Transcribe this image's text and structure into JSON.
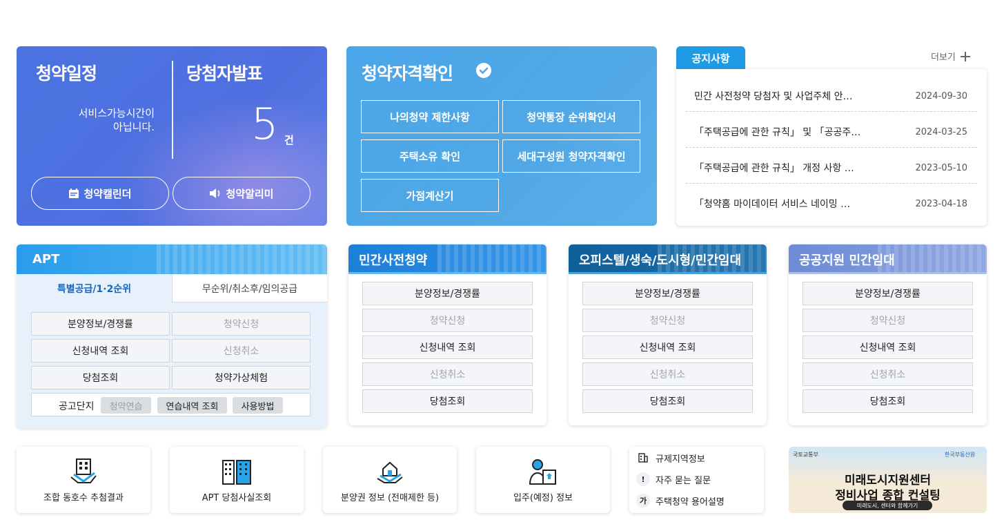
{
  "schedule": {
    "title": "청약일정",
    "notice": "서비스가능시간이\n아닙니다.",
    "calendar_label": "청약캘린더",
    "alarm_label": "청약알리미"
  },
  "winners": {
    "title": "당첨자발표",
    "count": "5",
    "unit": "건"
  },
  "qualification": {
    "title": "청약자격확인",
    "buttons": [
      "나의청약 제한사항",
      "청약통장 순위확인서",
      "주택소유 확인",
      "세대구성원 청약자격확인",
      "가점계산기"
    ]
  },
  "notices": {
    "tab": "공지사항",
    "more": "더보기",
    "items": [
      {
        "title": "민간 사전청약 당첨자 및 사업주체 안…",
        "date": "2024-09-30"
      },
      {
        "title": "「주택공급에 관한 규칙」 및 「공공주…",
        "date": "2024-03-25"
      },
      {
        "title": "「주택공급에 관한 규칙」 개정 사항 …",
        "date": "2023-05-10"
      },
      {
        "title": "「청약홈 마이데이터 서비스 네이밍 …",
        "date": "2023-04-18"
      }
    ]
  },
  "apt": {
    "title": "APT",
    "tabs": [
      "특별공급/1·2순위",
      "무순위/취소후/임의공급"
    ],
    "buttons": [
      "분양정보/경쟁률",
      "청약신청",
      "신청내역 조회",
      "신청취소",
      "당첨조회",
      "청약가상체험"
    ],
    "practice_label": "공고단지",
    "chips": [
      "청약연습",
      "연습내역 조회",
      "사용방법"
    ]
  },
  "pre_sale": {
    "title": "민간사전청약",
    "buttons": [
      "분양정보/경쟁률",
      "청약신청",
      "신청내역 조회",
      "신청취소",
      "당첨조회"
    ]
  },
  "officetel": {
    "title": "오피스텔/생숙/도시형/민간임대",
    "buttons": [
      "분양정보/경쟁률",
      "청약신청",
      "신청내역 조회",
      "신청취소",
      "당첨조회"
    ]
  },
  "public_rental": {
    "title": "공공지원 민간임대",
    "buttons": [
      "분양정보/경쟁률",
      "청약신청",
      "신청내역 조회",
      "신청취소",
      "당첨조회"
    ]
  },
  "quick_links": [
    {
      "label": "조합 동호수 추첨결과",
      "icon": "building-hand-icon"
    },
    {
      "label": "APT 당첨사실조회",
      "icon": "apartment-icon"
    },
    {
      "label": "분양권 정보 (전매제한 등)",
      "icon": "house-hand-icon"
    },
    {
      "label": "입주(예정) 정보",
      "icon": "person-document-icon"
    }
  ],
  "faq": [
    {
      "label": "규제지역정보",
      "icon": "building-icon"
    },
    {
      "label": "자주 묻는 질문",
      "icon": "exclamation-icon",
      "glyph": "!"
    },
    {
      "label": "주택청약 용어설명",
      "icon": "glossary-icon",
      "glyph": "가"
    }
  ],
  "banner": {
    "org1": "국토교통부",
    "org2": "한국부동산원",
    "line1": "미래도시지원센터",
    "line2": "정비사업 종합 컨설팅",
    "tagline": "미래도시, 센터와 함께가기"
  },
  "colors": {
    "schedule_bg": "#4f6fe0",
    "qual_bg": "#51a8e6",
    "notice_tab": "#1f9ae4",
    "pre_sale_head": "#1e7fd8",
    "officetel_head": "#0f5f9a",
    "public_head": "#6d8bd6"
  }
}
